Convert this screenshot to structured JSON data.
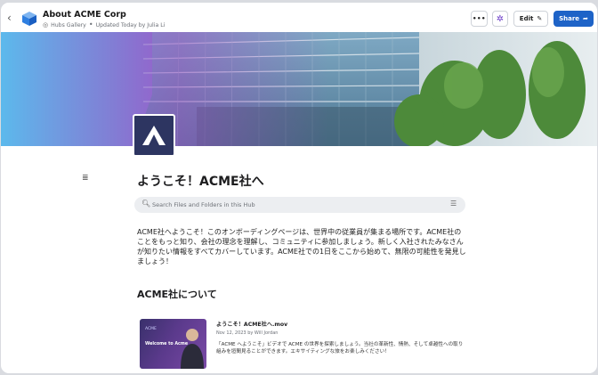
{
  "header": {
    "back_glyph": "‹",
    "title": "About ACME Corp",
    "meta_gallery": "Hubs Gallery",
    "meta_separator": "•",
    "meta_updated": "Updated Today by Julia Li",
    "more_label": "•••",
    "edit_label": "Edit",
    "share_label": "Share"
  },
  "colors": {
    "accent": "#1e63c7",
    "logo_bg": "#2d3561",
    "gear": "#6d3fc8"
  },
  "logo_letter": "A",
  "main": {
    "title": "ようこそ！ACME社へ",
    "search_placeholder": "Search Files and Folders in this Hub",
    "intro": "ACME社へようこそ！このオンボーディングページは、世界中の従業員が集まる場所です。ACME社のことをもっと知り、会社の理念を理解し、コミュニティに参加しましょう。新しく入社されたみなさんが知りたい情報をすべてカバーしています。ACME社での1日をここから始めて、無限の可能性を発見しましょう！",
    "section_heading": "ACME社について"
  },
  "card": {
    "thumb_brand": "ACME",
    "thumb_text": "Welcome to Acme",
    "title": "ようこそ！ACME社へ.mov",
    "meta": "Nov 12, 2023 by Will Jordan",
    "description": "「ACME へようこそ」ビデオで ACME の世界を探索しましょう。当社の革新性、情熱、そして卓越性への取り組みを垣間見ることができます。エキサイティングな旅をお楽しみください！"
  },
  "icons": [
    "chevron-left-icon",
    "hub-cube-icon",
    "gallery-icon",
    "gear-icon",
    "pencil-icon",
    "share-arrow-icon",
    "menu-lines-icon",
    "search-icon",
    "filter-icon",
    "acme-logo-icon"
  ]
}
